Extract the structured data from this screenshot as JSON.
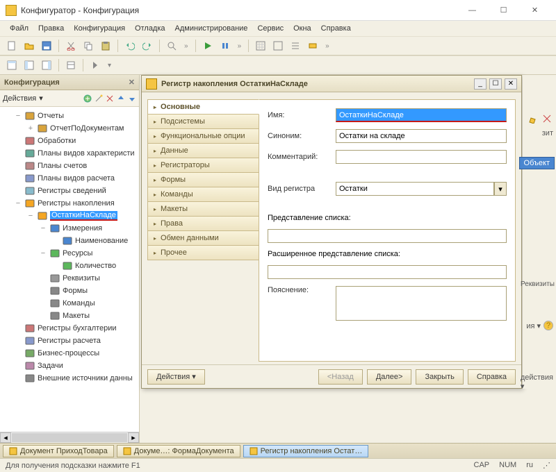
{
  "window": {
    "title": "Конфигуратор - Конфигурация"
  },
  "menu": [
    "Файл",
    "Правка",
    "Конфигурация",
    "Отладка",
    "Администрирование",
    "Сервис",
    "Окна",
    "Справка"
  ],
  "left_panel": {
    "title": "Конфигурация",
    "actions_label": "Действия",
    "tree": [
      {
        "toggle": "−",
        "icon": "report",
        "label": "Отчеты",
        "indent": 1
      },
      {
        "toggle": "+",
        "icon": "report-item",
        "label": "ОтчетПоДокументам",
        "indent": 2
      },
      {
        "toggle": "",
        "icon": "processing",
        "label": "Обработки",
        "indent": 1
      },
      {
        "toggle": "",
        "icon": "char-plan",
        "label": "Планы видов характеристи",
        "indent": 1
      },
      {
        "toggle": "",
        "icon": "account-plan",
        "label": "Планы счетов",
        "indent": 1
      },
      {
        "toggle": "",
        "icon": "calc-plan",
        "label": "Планы видов расчета",
        "indent": 1
      },
      {
        "toggle": "",
        "icon": "info-reg",
        "label": "Регистры сведений",
        "indent": 1
      },
      {
        "toggle": "−",
        "icon": "accum-reg",
        "label": "Регистры накопления",
        "indent": 1
      },
      {
        "toggle": "−",
        "icon": "accum-reg-item",
        "label": "ОстаткиНаСкладе",
        "indent": 2,
        "selected": true
      },
      {
        "toggle": "−",
        "icon": "dimensions",
        "label": "Измерения",
        "indent": 3
      },
      {
        "toggle": "",
        "icon": "dim-item",
        "label": "Наименование",
        "indent": 4
      },
      {
        "toggle": "−",
        "icon": "resources",
        "label": "Ресурсы",
        "indent": 3
      },
      {
        "toggle": "",
        "icon": "res-item",
        "label": "Количество",
        "indent": 4
      },
      {
        "toggle": "",
        "icon": "attrs",
        "label": "Реквизиты",
        "indent": 3
      },
      {
        "toggle": "",
        "icon": "forms",
        "label": "Формы",
        "indent": 3
      },
      {
        "toggle": "",
        "icon": "commands",
        "label": "Команды",
        "indent": 3
      },
      {
        "toggle": "",
        "icon": "templates",
        "label": "Макеты",
        "indent": 3
      },
      {
        "toggle": "",
        "icon": "accounting-reg",
        "label": "Регистры бухгалтерии",
        "indent": 1
      },
      {
        "toggle": "",
        "icon": "calc-reg",
        "label": "Регистры расчета",
        "indent": 1
      },
      {
        "toggle": "",
        "icon": "bp",
        "label": "Бизнес-процессы",
        "indent": 1
      },
      {
        "toggle": "",
        "icon": "tasks",
        "label": "Задачи",
        "indent": 1
      },
      {
        "toggle": "",
        "icon": "ext-src",
        "label": "Внешние источники данны",
        "indent": 1
      }
    ]
  },
  "modal": {
    "title": "Регистр накопления ОстаткиНаСкладе",
    "tabs": [
      "Основные",
      "Подсистемы",
      "Функциональные опции",
      "Данные",
      "Регистраторы",
      "Формы",
      "Команды",
      "Макеты",
      "Права",
      "Обмен данными",
      "Прочее"
    ],
    "active_tab": 0,
    "fields": {
      "name_label": "Имя:",
      "name_value": "ОстаткиНаСкладе",
      "synonym_label": "Синоним:",
      "synonym_value": "Остатки на складе",
      "comment_label": "Комментарий:",
      "comment_value": "",
      "regtype_label": "Вид регистра",
      "regtype_value": "Остатки",
      "listrep_label": "Представление списка:",
      "listrep_value": "",
      "extlistrep_label": "Расширенное представление списка:",
      "extlistrep_value": "",
      "explain_label": "Пояснение:",
      "explain_value": ""
    },
    "footer": {
      "actions": "Действия",
      "back": "<Назад",
      "next": "Далее>",
      "close": "Закрыть",
      "help": "Справка"
    }
  },
  "right_edge": {
    "badge": "Объект",
    "label2": "Реквизиты",
    "hint3": "зит",
    "hint4": "ия ▾",
    "hint5": "действия ▾"
  },
  "taskbar": [
    {
      "label": "Документ ПриходТовара",
      "active": false
    },
    {
      "label": "Докуме…: ФормаДокумента",
      "active": false
    },
    {
      "label": "Регистр накопления Остат…",
      "active": true
    }
  ],
  "statusbar": {
    "hint": "Для получения подсказки нажмите F1",
    "cap": "CAP",
    "num": "NUM",
    "lang": "ru"
  }
}
